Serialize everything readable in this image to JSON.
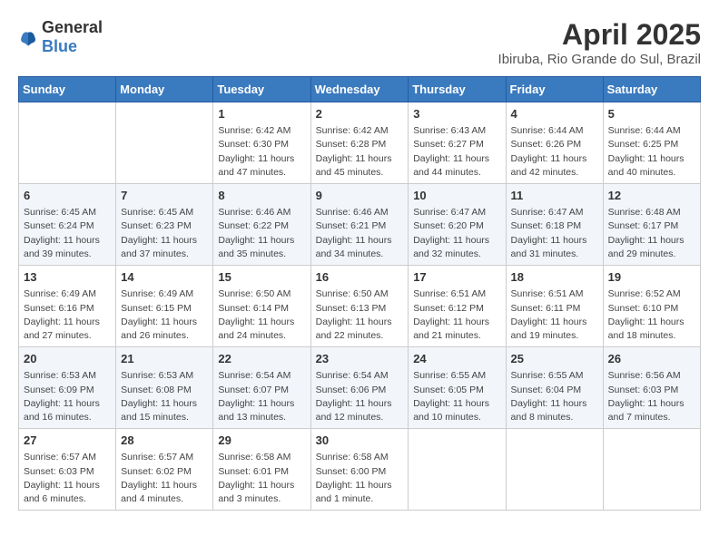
{
  "logo": {
    "text_general": "General",
    "text_blue": "Blue",
    "icon_color": "#3a7abf"
  },
  "title": "April 2025",
  "subtitle": "Ibiruba, Rio Grande do Sul, Brazil",
  "days_of_week": [
    "Sunday",
    "Monday",
    "Tuesday",
    "Wednesday",
    "Thursday",
    "Friday",
    "Saturday"
  ],
  "weeks": [
    [
      {
        "day": "",
        "sunrise": "",
        "sunset": "",
        "daylight": ""
      },
      {
        "day": "",
        "sunrise": "",
        "sunset": "",
        "daylight": ""
      },
      {
        "day": "1",
        "sunrise": "Sunrise: 6:42 AM",
        "sunset": "Sunset: 6:30 PM",
        "daylight": "Daylight: 11 hours and 47 minutes."
      },
      {
        "day": "2",
        "sunrise": "Sunrise: 6:42 AM",
        "sunset": "Sunset: 6:28 PM",
        "daylight": "Daylight: 11 hours and 45 minutes."
      },
      {
        "day": "3",
        "sunrise": "Sunrise: 6:43 AM",
        "sunset": "Sunset: 6:27 PM",
        "daylight": "Daylight: 11 hours and 44 minutes."
      },
      {
        "day": "4",
        "sunrise": "Sunrise: 6:44 AM",
        "sunset": "Sunset: 6:26 PM",
        "daylight": "Daylight: 11 hours and 42 minutes."
      },
      {
        "day": "5",
        "sunrise": "Sunrise: 6:44 AM",
        "sunset": "Sunset: 6:25 PM",
        "daylight": "Daylight: 11 hours and 40 minutes."
      }
    ],
    [
      {
        "day": "6",
        "sunrise": "Sunrise: 6:45 AM",
        "sunset": "Sunset: 6:24 PM",
        "daylight": "Daylight: 11 hours and 39 minutes."
      },
      {
        "day": "7",
        "sunrise": "Sunrise: 6:45 AM",
        "sunset": "Sunset: 6:23 PM",
        "daylight": "Daylight: 11 hours and 37 minutes."
      },
      {
        "day": "8",
        "sunrise": "Sunrise: 6:46 AM",
        "sunset": "Sunset: 6:22 PM",
        "daylight": "Daylight: 11 hours and 35 minutes."
      },
      {
        "day": "9",
        "sunrise": "Sunrise: 6:46 AM",
        "sunset": "Sunset: 6:21 PM",
        "daylight": "Daylight: 11 hours and 34 minutes."
      },
      {
        "day": "10",
        "sunrise": "Sunrise: 6:47 AM",
        "sunset": "Sunset: 6:20 PM",
        "daylight": "Daylight: 11 hours and 32 minutes."
      },
      {
        "day": "11",
        "sunrise": "Sunrise: 6:47 AM",
        "sunset": "Sunset: 6:18 PM",
        "daylight": "Daylight: 11 hours and 31 minutes."
      },
      {
        "day": "12",
        "sunrise": "Sunrise: 6:48 AM",
        "sunset": "Sunset: 6:17 PM",
        "daylight": "Daylight: 11 hours and 29 minutes."
      }
    ],
    [
      {
        "day": "13",
        "sunrise": "Sunrise: 6:49 AM",
        "sunset": "Sunset: 6:16 PM",
        "daylight": "Daylight: 11 hours and 27 minutes."
      },
      {
        "day": "14",
        "sunrise": "Sunrise: 6:49 AM",
        "sunset": "Sunset: 6:15 PM",
        "daylight": "Daylight: 11 hours and 26 minutes."
      },
      {
        "day": "15",
        "sunrise": "Sunrise: 6:50 AM",
        "sunset": "Sunset: 6:14 PM",
        "daylight": "Daylight: 11 hours and 24 minutes."
      },
      {
        "day": "16",
        "sunrise": "Sunrise: 6:50 AM",
        "sunset": "Sunset: 6:13 PM",
        "daylight": "Daylight: 11 hours and 22 minutes."
      },
      {
        "day": "17",
        "sunrise": "Sunrise: 6:51 AM",
        "sunset": "Sunset: 6:12 PM",
        "daylight": "Daylight: 11 hours and 21 minutes."
      },
      {
        "day": "18",
        "sunrise": "Sunrise: 6:51 AM",
        "sunset": "Sunset: 6:11 PM",
        "daylight": "Daylight: 11 hours and 19 minutes."
      },
      {
        "day": "19",
        "sunrise": "Sunrise: 6:52 AM",
        "sunset": "Sunset: 6:10 PM",
        "daylight": "Daylight: 11 hours and 18 minutes."
      }
    ],
    [
      {
        "day": "20",
        "sunrise": "Sunrise: 6:53 AM",
        "sunset": "Sunset: 6:09 PM",
        "daylight": "Daylight: 11 hours and 16 minutes."
      },
      {
        "day": "21",
        "sunrise": "Sunrise: 6:53 AM",
        "sunset": "Sunset: 6:08 PM",
        "daylight": "Daylight: 11 hours and 15 minutes."
      },
      {
        "day": "22",
        "sunrise": "Sunrise: 6:54 AM",
        "sunset": "Sunset: 6:07 PM",
        "daylight": "Daylight: 11 hours and 13 minutes."
      },
      {
        "day": "23",
        "sunrise": "Sunrise: 6:54 AM",
        "sunset": "Sunset: 6:06 PM",
        "daylight": "Daylight: 11 hours and 12 minutes."
      },
      {
        "day": "24",
        "sunrise": "Sunrise: 6:55 AM",
        "sunset": "Sunset: 6:05 PM",
        "daylight": "Daylight: 11 hours and 10 minutes."
      },
      {
        "day": "25",
        "sunrise": "Sunrise: 6:55 AM",
        "sunset": "Sunset: 6:04 PM",
        "daylight": "Daylight: 11 hours and 8 minutes."
      },
      {
        "day": "26",
        "sunrise": "Sunrise: 6:56 AM",
        "sunset": "Sunset: 6:03 PM",
        "daylight": "Daylight: 11 hours and 7 minutes."
      }
    ],
    [
      {
        "day": "27",
        "sunrise": "Sunrise: 6:57 AM",
        "sunset": "Sunset: 6:03 PM",
        "daylight": "Daylight: 11 hours and 6 minutes."
      },
      {
        "day": "28",
        "sunrise": "Sunrise: 6:57 AM",
        "sunset": "Sunset: 6:02 PM",
        "daylight": "Daylight: 11 hours and 4 minutes."
      },
      {
        "day": "29",
        "sunrise": "Sunrise: 6:58 AM",
        "sunset": "Sunset: 6:01 PM",
        "daylight": "Daylight: 11 hours and 3 minutes."
      },
      {
        "day": "30",
        "sunrise": "Sunrise: 6:58 AM",
        "sunset": "Sunset: 6:00 PM",
        "daylight": "Daylight: 11 hours and 1 minute."
      },
      {
        "day": "",
        "sunrise": "",
        "sunset": "",
        "daylight": ""
      },
      {
        "day": "",
        "sunrise": "",
        "sunset": "",
        "daylight": ""
      },
      {
        "day": "",
        "sunrise": "",
        "sunset": "",
        "daylight": ""
      }
    ]
  ]
}
